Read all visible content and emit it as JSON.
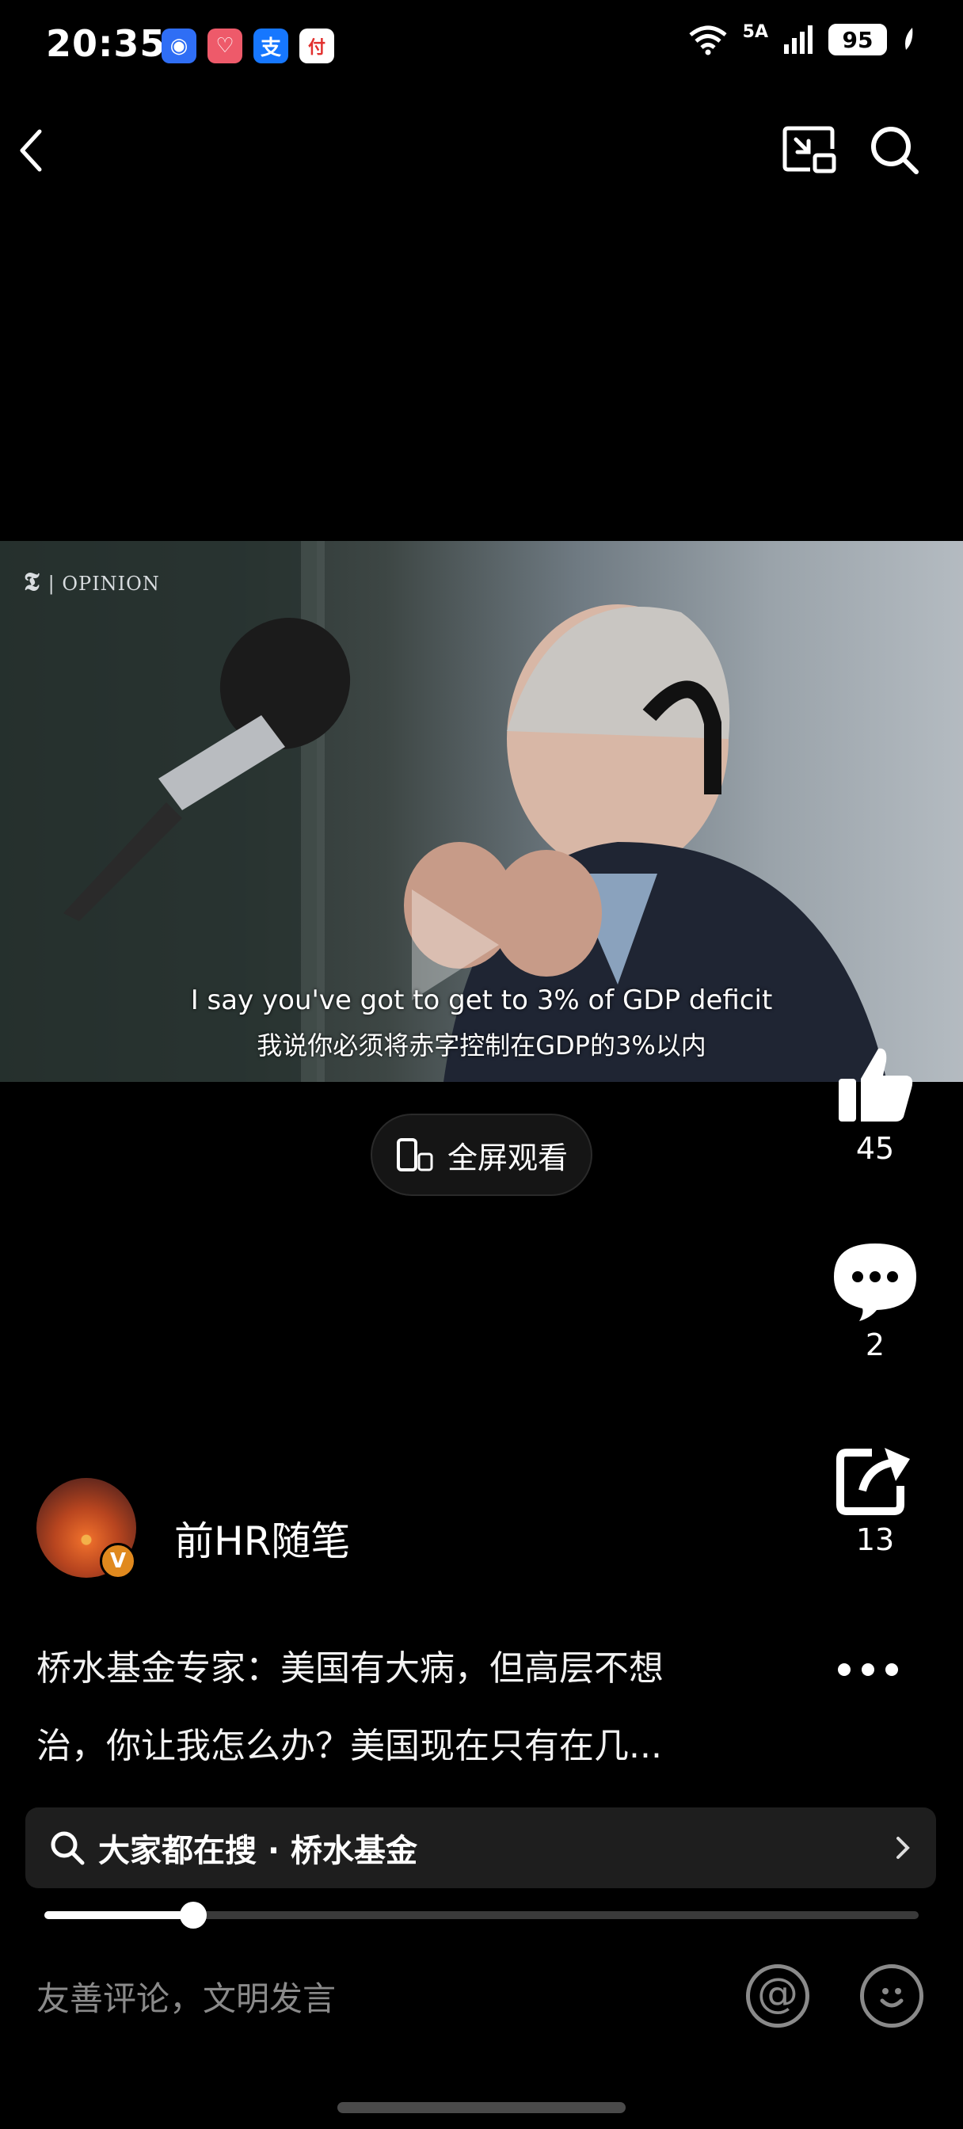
{
  "status_bar": {
    "time": "20:35",
    "network": "5A",
    "battery": "95",
    "apps": [
      {
        "name": "contacts-app-icon",
        "glyph": "◉",
        "color": "#2f6ef5"
      },
      {
        "name": "health-app-icon",
        "glyph": "♡",
        "color": "#ee5a6a"
      },
      {
        "name": "alipay-app-icon",
        "glyph": "支",
        "color": "#1677ff"
      },
      {
        "name": "pay-app-icon",
        "glyph": "付",
        "color": "#e2302e"
      }
    ]
  },
  "video": {
    "watermark": "OPINION",
    "subtitle_en": "I say you've got to get to 3% of GDP deficit",
    "subtitle_zh": "我说你必须将赤字控制在GDP的3%以内"
  },
  "fullscreen_label": "全屏观看",
  "actions": {
    "likes": "45",
    "comments": "2",
    "shares": "13"
  },
  "author": {
    "name": "前HR随笔",
    "badge": "V"
  },
  "caption": {
    "line1": "桥水基金专家：美国有大病，但高层不想",
    "line2": "治，你让我怎么办？美国现在只有在几..."
  },
  "search": {
    "label": "大家都在搜 · 桥水基金"
  },
  "progress": 0.17,
  "comment_placeholder": "友善评论，文明发言"
}
